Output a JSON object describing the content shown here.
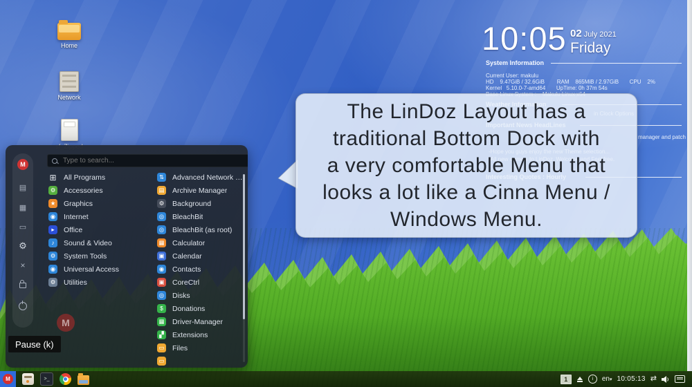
{
  "desktop_icons": [
    {
      "label": "Home"
    },
    {
      "label": "Network"
    },
    {
      "label": "sf_Zipped"
    }
  ],
  "clock": {
    "time": "10:05",
    "day": "02",
    "month_year": "July 2021",
    "weekday": "Friday"
  },
  "conky": {
    "sys_title": "System Information",
    "sys_lines": [
      "Current User: makulu",
      "HD    9.47GiB / 32.6GiB        RAM    865MiB / 2.97GiB       CPU    2%",
      "Kernel   5.10.0-7-amd64       UpTime: 0h 37m 54s",
      "Base Linux System :    Makulu Linux x64"
    ],
    "weather_title": "Weather Information",
    "weather_fragment": "in Clock Options",
    "news_title": "Important News HeadLines",
    "news_fragment": "manager and patch",
    "news_lines": [
      "-Hope you guys enjoy the new Theme selection...",
      "-All new comers to LinDoz, Welcome and Feel free."
    ],
    "quotes_title": "Interesting Quotes : Hourly"
  },
  "bubble": {
    "lines": [
      "The LinDoz Layout has a",
      "traditional Bottom Dock with",
      "a very comfortable Menu that",
      "looks a lot like a Cinna Menu /",
      "Windows Menu."
    ]
  },
  "menu": {
    "search_placeholder": "Type to search...",
    "logo_letter": "M",
    "sidebar_glyphs": {
      "profile": "▤",
      "pictures": "▦",
      "folders": "▭",
      "settings": "⚙",
      "close": "×"
    },
    "left_items": [
      {
        "label": "All Programs",
        "glyph": "⊞",
        "color": "transparent"
      },
      {
        "label": "Accessories",
        "glyph": "⚙",
        "color": "#56ae3f"
      },
      {
        "label": "Graphics",
        "glyph": "★",
        "color": "#ef8a2a"
      },
      {
        "label": "Internet",
        "glyph": "◉",
        "color": "#2e86d9"
      },
      {
        "label": "Office",
        "glyph": "▸",
        "color": "#2b4fd8"
      },
      {
        "label": "Sound & Video",
        "glyph": "♪",
        "color": "#2e86d9"
      },
      {
        "label": "System Tools",
        "glyph": "⚙",
        "color": "#2e86d9"
      },
      {
        "label": "Universal Access",
        "glyph": "◉",
        "color": "#2e86d9"
      },
      {
        "label": "Utilities",
        "glyph": "⚙",
        "color": "#6d7f95"
      }
    ],
    "right_items": [
      {
        "label": "Advanced Network Configura...",
        "glyph": "⇅",
        "color": "#2e86d9"
      },
      {
        "label": "Archive Manager",
        "glyph": "▤",
        "color": "#f0a832"
      },
      {
        "label": "Background",
        "glyph": "⚙",
        "color": "#454c5a"
      },
      {
        "label": "BleachBit",
        "glyph": "◎",
        "color": "#2e86d9"
      },
      {
        "label": "BleachBit (as root)",
        "glyph": "◎",
        "color": "#2e86d9"
      },
      {
        "label": "Calculator",
        "glyph": "▦",
        "color": "#ef8a2a"
      },
      {
        "label": "Calendar",
        "glyph": "▣",
        "color": "#3f6fd8"
      },
      {
        "label": "Contacts",
        "glyph": "◉",
        "color": "#2e86d9"
      },
      {
        "label": "CoreCtrl",
        "glyph": "▣",
        "color": "#d84f3f"
      },
      {
        "label": "Disks",
        "glyph": "◎",
        "color": "#2e86d9"
      },
      {
        "label": "Donations",
        "glyph": "$",
        "color": "#35b34a"
      },
      {
        "label": "Driver-Manager",
        "glyph": "▦",
        "color": "#35b34a"
      },
      {
        "label": "Extensions",
        "glyph": "▞",
        "color": "#35b34a"
      },
      {
        "label": "Files",
        "glyph": "▭",
        "color": "#f0a832"
      },
      {
        "label": "",
        "glyph": "▭",
        "color": "#f0a832"
      }
    ],
    "watermark_letter": "M"
  },
  "video_overlay": {
    "pause_label": "Pause (k)"
  },
  "taskbar": {
    "menu_logo_letter": "M",
    "terminal_glyph": ">_",
    "tray": {
      "workspace": "1",
      "info_glyph": "i",
      "language": "en",
      "time": "10:05:13",
      "arrows_glyph": "⇄"
    }
  },
  "colors": {
    "accent_blue": "#2f6bdc",
    "makulu_red": "#d32f2f",
    "grass_green": "#58b427",
    "sky_blue": "#3b66c6"
  }
}
